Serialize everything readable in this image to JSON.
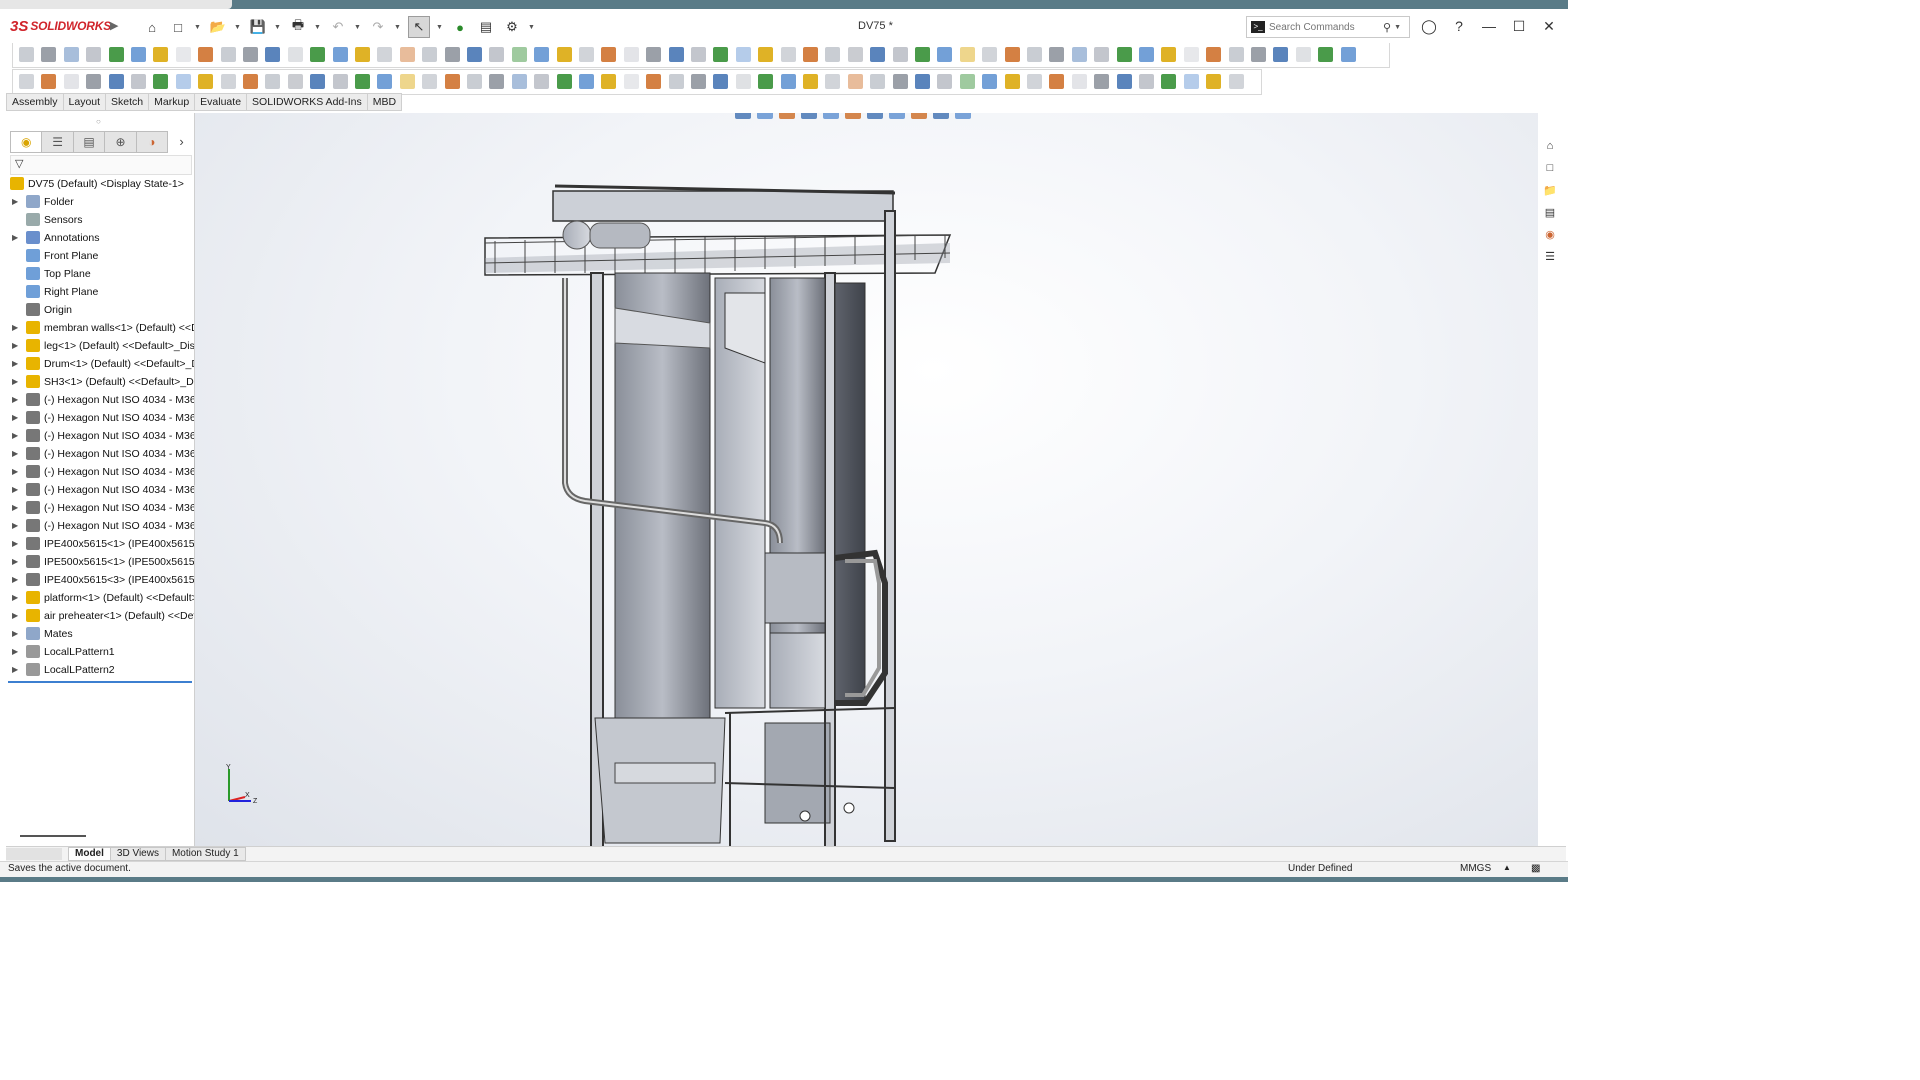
{
  "app": {
    "logo_prefix": "3S",
    "logo_text": "SOLIDWORKS",
    "document_title": "DV75 *",
    "colors": {
      "brand": "#d0242b",
      "accent": "#3c7fd0",
      "frame": "#5a7b87"
    }
  },
  "search": {
    "placeholder": "Search Commands"
  },
  "command_tabs": [
    "Assembly",
    "Layout",
    "Sketch",
    "Markup",
    "Evaluate",
    "SOLIDWORKS Add-Ins",
    "MBD"
  ],
  "feature_tree": {
    "items": [
      {
        "label": "DV75 (Default) <Display State-1>",
        "icon": "assembly-icon",
        "expandable": false,
        "indent": 0
      },
      {
        "label": "Folder",
        "icon": "folder-icon",
        "expandable": true,
        "indent": 1
      },
      {
        "label": "Sensors",
        "icon": "sensor-icon",
        "expandable": false,
        "indent": 1
      },
      {
        "label": "Annotations",
        "icon": "annotation-icon",
        "expandable": true,
        "indent": 1
      },
      {
        "label": "Front Plane",
        "icon": "plane-icon",
        "expandable": false,
        "indent": 1
      },
      {
        "label": "Top Plane",
        "icon": "plane-icon",
        "expandable": false,
        "indent": 1
      },
      {
        "label": "Right Plane",
        "icon": "plane-icon",
        "expandable": false,
        "indent": 1
      },
      {
        "label": "Origin",
        "icon": "origin-icon",
        "expandable": false,
        "indent": 1
      },
      {
        "label": "membran walls<1> (Default) <<D",
        "icon": "subassembly-icon",
        "expandable": true,
        "indent": 1
      },
      {
        "label": "leg<1> (Default) <<Default>_Disp",
        "icon": "subassembly-icon",
        "expandable": true,
        "indent": 1
      },
      {
        "label": "Drum<1> (Default) <<Default>_D",
        "icon": "subassembly-icon",
        "expandable": true,
        "indent": 1
      },
      {
        "label": "SH3<1> (Default) <<Default>_Dis",
        "icon": "subassembly-icon",
        "expandable": true,
        "indent": 1
      },
      {
        "label": "(-) Hexagon Nut ISO 4034 - M36 -",
        "icon": "part-icon",
        "expandable": true,
        "indent": 1
      },
      {
        "label": "(-) Hexagon Nut ISO 4034 - M36 -",
        "icon": "part-icon",
        "expandable": true,
        "indent": 1
      },
      {
        "label": "(-) Hexagon Nut ISO 4034 - M36 -",
        "icon": "part-icon",
        "expandable": true,
        "indent": 1
      },
      {
        "label": "(-) Hexagon Nut ISO 4034 - M36 -",
        "icon": "part-icon",
        "expandable": true,
        "indent": 1
      },
      {
        "label": "(-) Hexagon Nut ISO 4034 - M36 -",
        "icon": "part-icon",
        "expandable": true,
        "indent": 1
      },
      {
        "label": "(-) Hexagon Nut ISO 4034 - M36 -",
        "icon": "part-icon",
        "expandable": true,
        "indent": 1
      },
      {
        "label": "(-) Hexagon Nut ISO 4034 - M36 -",
        "icon": "part-icon",
        "expandable": true,
        "indent": 1
      },
      {
        "label": "(-) Hexagon Nut ISO 4034 - M36 -",
        "icon": "part-icon",
        "expandable": true,
        "indent": 1
      },
      {
        "label": "IPE400x5615<1> (IPE400x5615) <D",
        "icon": "part-icon",
        "expandable": true,
        "indent": 1
      },
      {
        "label": "IPE500x5615<1> (IPE500x5615) <D",
        "icon": "part-icon",
        "expandable": true,
        "indent": 1
      },
      {
        "label": "IPE400x5615<3> (IPE400x5615) <D",
        "icon": "part-icon",
        "expandable": true,
        "indent": 1
      },
      {
        "label": "platform<1> (Default) <<Default>",
        "icon": "subassembly-icon",
        "expandable": true,
        "indent": 1
      },
      {
        "label": "air preheater<1> (Default) <<Defa",
        "icon": "subassembly-icon",
        "expandable": true,
        "indent": 1
      },
      {
        "label": "Mates",
        "icon": "mates-icon",
        "expandable": true,
        "indent": 1
      },
      {
        "label": "LocalLPattern1",
        "icon": "pattern-icon",
        "expandable": true,
        "indent": 1
      },
      {
        "label": "LocalLPattern2",
        "icon": "pattern-icon",
        "expandable": true,
        "indent": 1
      }
    ]
  },
  "bottom_tabs": [
    "Model",
    "3D Views",
    "Motion Study 1"
  ],
  "status": {
    "message": "Saves the active document.",
    "definition": "Under Defined",
    "units": "MMGS"
  },
  "triad": {
    "y_label": "Y",
    "x_label": "X",
    "z_label": "Z"
  }
}
